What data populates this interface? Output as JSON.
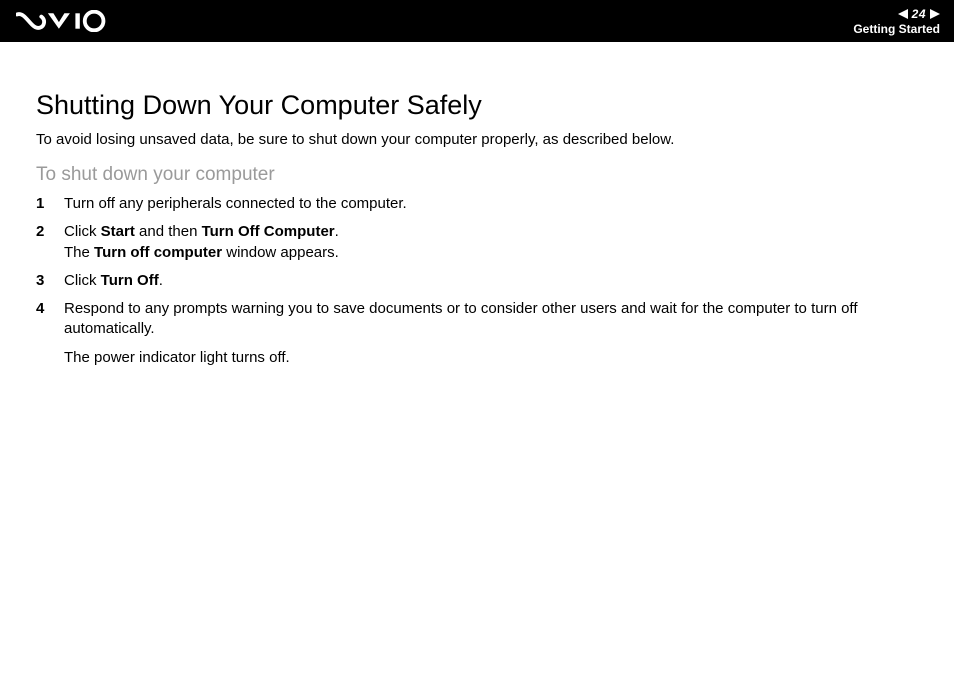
{
  "header": {
    "page_number": "24",
    "section": "Getting Started"
  },
  "title": "Shutting Down Your Computer Safely",
  "intro": "To avoid losing unsaved data, be sure to shut down your computer properly, as described below.",
  "subtitle": "To shut down your computer",
  "steps": [
    {
      "pre1": "Turn off any peripherals connected to the computer."
    },
    {
      "pre1": "Click ",
      "b1": "Start",
      "mid1": " and then ",
      "b2": "Turn Off Computer",
      "post1": ".",
      "line2_pre": "The ",
      "line2_b": "Turn off computer",
      "line2_post": " window appears."
    },
    {
      "pre1": "Click ",
      "b1": "Turn Off",
      "post1": "."
    },
    {
      "pre1": "Respond to any prompts warning you to save documents or to consider other users and wait for the computer to turn off automatically.",
      "after": "The power indicator light turns off."
    }
  ]
}
